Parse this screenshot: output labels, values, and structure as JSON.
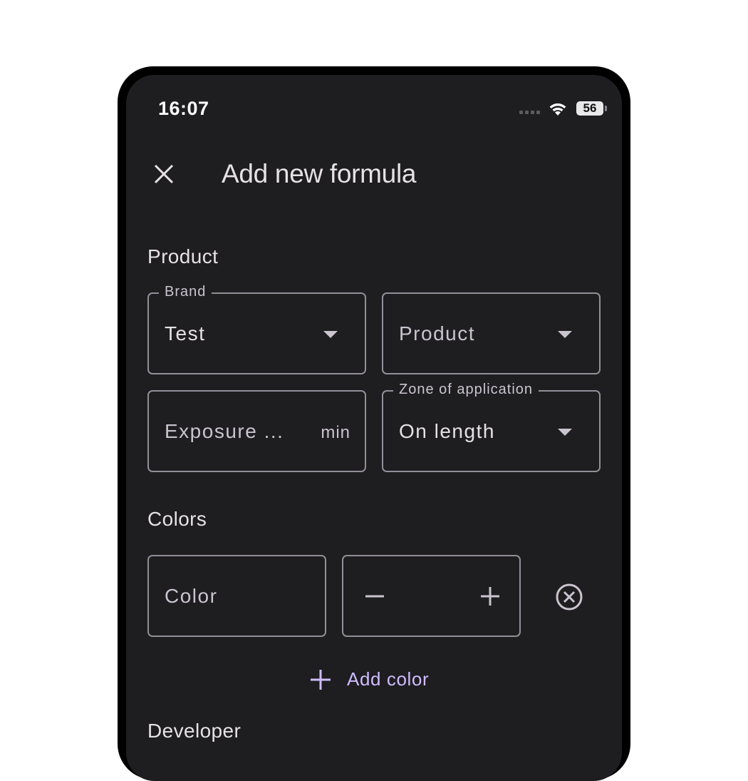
{
  "status_bar": {
    "time": "16:07",
    "battery": "56"
  },
  "app_bar": {
    "close_icon": "close-icon",
    "title": "Add new formula"
  },
  "product_section": {
    "heading": "Product",
    "brand": {
      "legend": "Brand",
      "value": "Test"
    },
    "product": {
      "placeholder": "Product"
    },
    "exposure": {
      "placeholder": "Exposure ...",
      "suffix": "min"
    },
    "zone": {
      "legend": "Zone of application",
      "value": "On length"
    }
  },
  "colors_section": {
    "heading": "Colors",
    "color_field": {
      "placeholder": "Color"
    },
    "stepper": {
      "minus_icon": "minus-icon",
      "plus_icon": "plus-icon"
    },
    "remove_icon": "remove-circle-icon",
    "add_color_label": "Add color"
  },
  "developer_section": {
    "heading": "Developer"
  },
  "colors": {
    "background": "#1e1d20",
    "outline": "#938f99",
    "accent": "#cfbcff",
    "text": "#e6e1e6"
  }
}
